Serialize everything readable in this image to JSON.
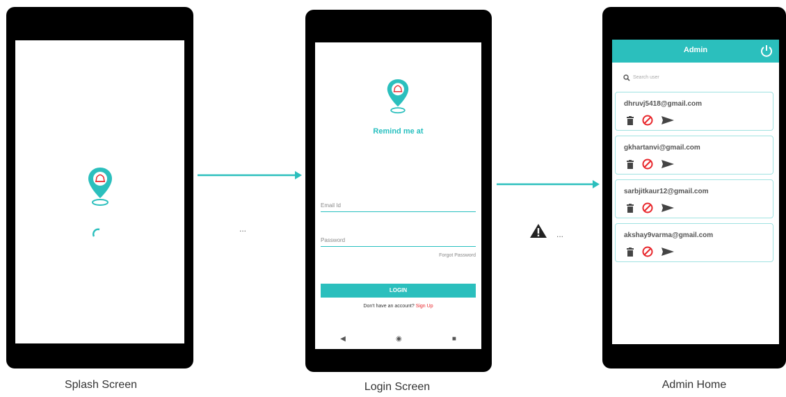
{
  "captions": {
    "splash": "Splash Screen",
    "login": "Login Screen",
    "admin": "Admin Home"
  },
  "connectors": {
    "ellipsis_1": "...",
    "ellipsis_2": "..."
  },
  "login": {
    "app_name": "Remind me at",
    "email_placeholder": "Email Id",
    "password_placeholder": "Password",
    "forgot_password": "Forgot Password",
    "login_button": "LOGIN",
    "no_account": "Don't have an account?",
    "sign_up": "Sign Up",
    "nav": {
      "back": "◀",
      "home": "◉",
      "recents": "■"
    }
  },
  "admin": {
    "title": "Admin",
    "search_placeholder": "Search user",
    "users": [
      {
        "email": "dhruvj5418@gmail.com"
      },
      {
        "email": "gkhartanvi@gmail.com"
      },
      {
        "email": "sarbjitkaur12@gmail.com"
      },
      {
        "email": "akshay9varma@gmail.com"
      }
    ]
  },
  "colors": {
    "accent": "#2bbfbd",
    "danger": "#e8262b",
    "frame": "#000000"
  },
  "icons": [
    "location-pin-bell-icon",
    "loading-spinner-icon",
    "arrow-right-icon",
    "warning-icon",
    "power-icon",
    "search-icon",
    "trash-icon",
    "block-icon",
    "send-icon"
  ]
}
